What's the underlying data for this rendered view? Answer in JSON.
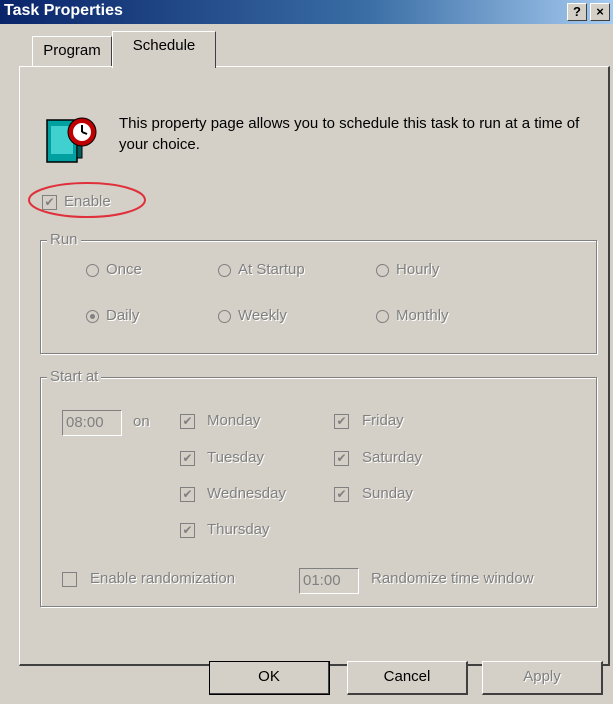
{
  "window": {
    "title": "Task Properties",
    "help_label": "?",
    "close_label": "×"
  },
  "tabs": [
    {
      "label": "Program"
    },
    {
      "label": "Schedule"
    }
  ],
  "description": "This property page allows you to schedule this task to run at a time of your choice.",
  "enable": {
    "label": "Enable",
    "checked": true,
    "highlight_color": "#e0303a"
  },
  "run": {
    "legend": "Run",
    "options": [
      {
        "label": "Once",
        "selected": false
      },
      {
        "label": "At Startup",
        "selected": false
      },
      {
        "label": "Hourly",
        "selected": false
      },
      {
        "label": "Daily",
        "selected": true
      },
      {
        "label": "Weekly",
        "selected": false
      },
      {
        "label": "Monthly",
        "selected": false
      }
    ]
  },
  "start_at": {
    "legend": "Start at",
    "time": "08:00",
    "on_label": "on",
    "days": [
      {
        "label": "Monday",
        "checked": true
      },
      {
        "label": "Tuesday",
        "checked": true
      },
      {
        "label": "Wednesday",
        "checked": true
      },
      {
        "label": "Thursday",
        "checked": true
      },
      {
        "label": "Friday",
        "checked": true
      },
      {
        "label": "Saturday",
        "checked": true
      },
      {
        "label": "Sunday",
        "checked": true
      }
    ],
    "randomization": {
      "label": "Enable randomization",
      "checked": false,
      "window_value": "01:00",
      "window_label": "Randomize time window"
    }
  },
  "buttons": {
    "ok": "OK",
    "cancel": "Cancel",
    "apply": "Apply"
  },
  "icons": {
    "task": "task-clock-icon",
    "checkmark": "checkmark-icon"
  }
}
